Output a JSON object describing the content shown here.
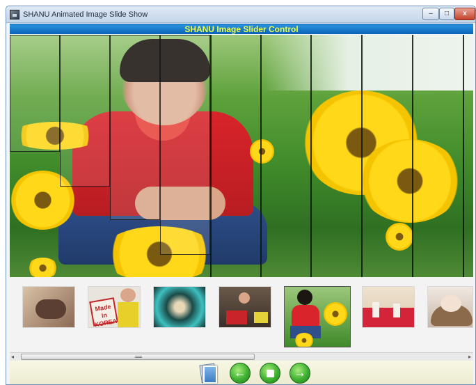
{
  "window": {
    "title": "SHANU Animated Image Slide Show",
    "minimize_glyph": "–",
    "maximize_glyph": "□",
    "close_glyph": "x"
  },
  "header": {
    "title": "SHANU Image Slider Control"
  },
  "thumbnails": {
    "items": [
      {
        "name": "baby-blanket",
        "selected": false
      },
      {
        "name": "made-in-korea",
        "selected": false
      },
      {
        "name": "kaleidoscope",
        "selected": false
      },
      {
        "name": "child-toys",
        "selected": false
      },
      {
        "name": "child-flowers",
        "selected": true
      },
      {
        "name": "kids-room",
        "selected": false
      },
      {
        "name": "baby-basket",
        "selected": false
      }
    ],
    "thumb2_text_line1": "Made In",
    "thumb2_text_line2": "KOREA"
  },
  "scrollbar": {
    "left_arrow": "◂",
    "right_arrow": "▸",
    "thumb_fraction": 0.53
  },
  "controls": {
    "photo_icon": "photo-stack-icon",
    "prev_glyph": "←",
    "stop_glyph": "",
    "next_glyph": "→"
  },
  "colors": {
    "header_bg": "#0a63b8",
    "header_text": "#f3ff3a",
    "control_green": "#3fb032"
  }
}
